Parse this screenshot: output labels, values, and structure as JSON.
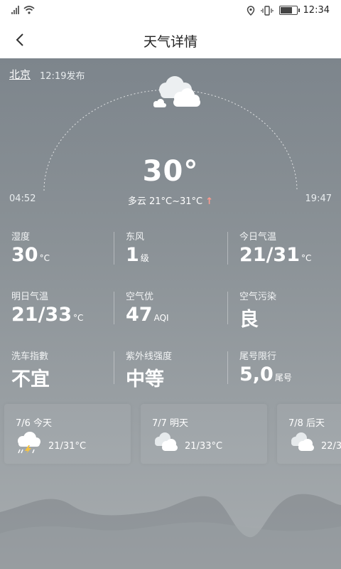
{
  "status_bar": {
    "time": "12:34"
  },
  "header": {
    "back_icon": "chevron-left-icon",
    "title": "天气详情"
  },
  "weather": {
    "city": "北京",
    "published": "12:19发布",
    "temperature": "30°",
    "condition": "多云",
    "range": "21°C~31°C",
    "trend_icon": "arrow-up-icon",
    "sunrise": "04:52",
    "sunset": "19:47"
  },
  "details": [
    {
      "label": "湿度",
      "value": "30",
      "unit": "°C"
    },
    {
      "label": "东风",
      "value": "1",
      "unit": "级"
    },
    {
      "label": "今日气温",
      "value": "21/31",
      "unit": "°C"
    },
    {
      "label": "明日气温",
      "value": "21/33",
      "unit": "°C"
    },
    {
      "label": "空气优",
      "value": "47",
      "unit": "AQI"
    },
    {
      "label": "空气污染",
      "value": "良",
      "unit": ""
    },
    {
      "label": "洗车指數",
      "value": "不宜",
      "unit": ""
    },
    {
      "label": "紫外线强度",
      "value": "中等",
      "unit": ""
    },
    {
      "label": "尾号限行",
      "value": "5,0",
      "unit": "尾号"
    }
  ],
  "forecast": [
    {
      "day": "7/6 今天",
      "temp": "21/31°C",
      "icon": "thunderstorm-cloud-icon"
    },
    {
      "day": "7/7 明天",
      "temp": "21/33°C",
      "icon": "cloudy-icon"
    },
    {
      "day": "7/8 后天",
      "temp": "22/3",
      "icon": "cloudy-icon"
    }
  ]
}
